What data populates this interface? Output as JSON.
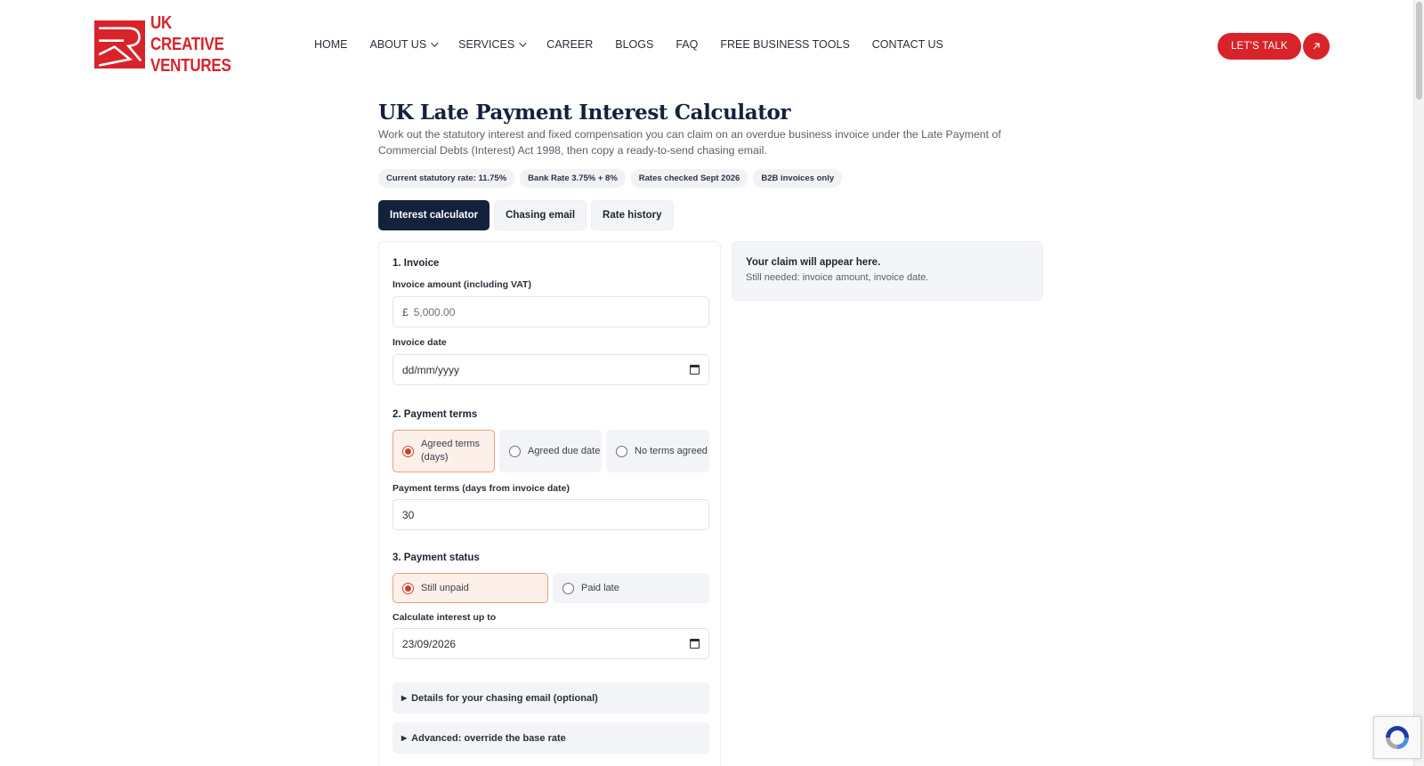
{
  "brand": {
    "name_line1": "UK",
    "name_line2": "CREATIVE",
    "name_line3": "VENTURES",
    "color": "#d8232a"
  },
  "nav": {
    "items": [
      {
        "label": "HOME",
        "dropdown": false
      },
      {
        "label": "ABOUT US",
        "dropdown": true
      },
      {
        "label": "SERVICES",
        "dropdown": true
      },
      {
        "label": "CAREER",
        "dropdown": false
      },
      {
        "label": "BLOGS",
        "dropdown": false
      },
      {
        "label": "FAQ",
        "dropdown": false
      },
      {
        "label": "FREE BUSINESS TOOLS",
        "dropdown": false
      },
      {
        "label": "CONTACT US",
        "dropdown": false
      }
    ],
    "cta_label": "LET'S TALK",
    "cta_icon": "arrow-up-right-icon"
  },
  "page": {
    "title": "UK Late Payment Interest Calculator",
    "description": "Work out the statutory interest and fixed compensation you can claim on an overdue business invoice under the Late Payment of Commercial Debts (Interest) Act 1998, then copy a ready-to-send chasing email.",
    "chips": [
      "Current statutory rate: 11.75%",
      "Bank Rate 3.75% + 8%",
      "Rates checked Sept 2026",
      "B2B invoices only"
    ],
    "tabs": [
      {
        "label": "Interest calculator",
        "active": true
      },
      {
        "label": "Chasing email",
        "active": false
      },
      {
        "label": "Rate history",
        "active": false
      }
    ]
  },
  "form": {
    "section1": "1. Invoice",
    "amount_label": "Invoice amount (including VAT)",
    "amount_prefix": "£",
    "amount_placeholder": "5,000.00",
    "invoice_date_label": "Invoice date",
    "invoice_date_value": "dd/mm/yyyy",
    "section2": "2. Payment terms",
    "terms_options": [
      {
        "label": "Agreed terms (days)",
        "selected": true
      },
      {
        "label": "Agreed due date",
        "selected": false
      },
      {
        "label": "No terms agreed",
        "selected": false
      }
    ],
    "terms_days_label": "Payment terms (days from invoice date)",
    "terms_days_value": "30",
    "section3": "3. Payment status",
    "status_options": [
      {
        "label": "Still unpaid",
        "selected": true
      },
      {
        "label": "Paid late",
        "selected": false
      }
    ],
    "calc_upto_label": "Calculate interest up to",
    "calc_upto_value": "23/09/2026",
    "details_email": "Details for your chasing email (optional)",
    "details_advanced": "Advanced: override the base rate"
  },
  "result": {
    "title": "Your claim will appear here.",
    "subtitle": "Still needed: invoice amount, invoice date."
  },
  "colors": {
    "navy": "#14213d",
    "accent_red": "#d8232a",
    "selected_bg": "#fdf0e9",
    "selected_border": "#e8a07f"
  }
}
